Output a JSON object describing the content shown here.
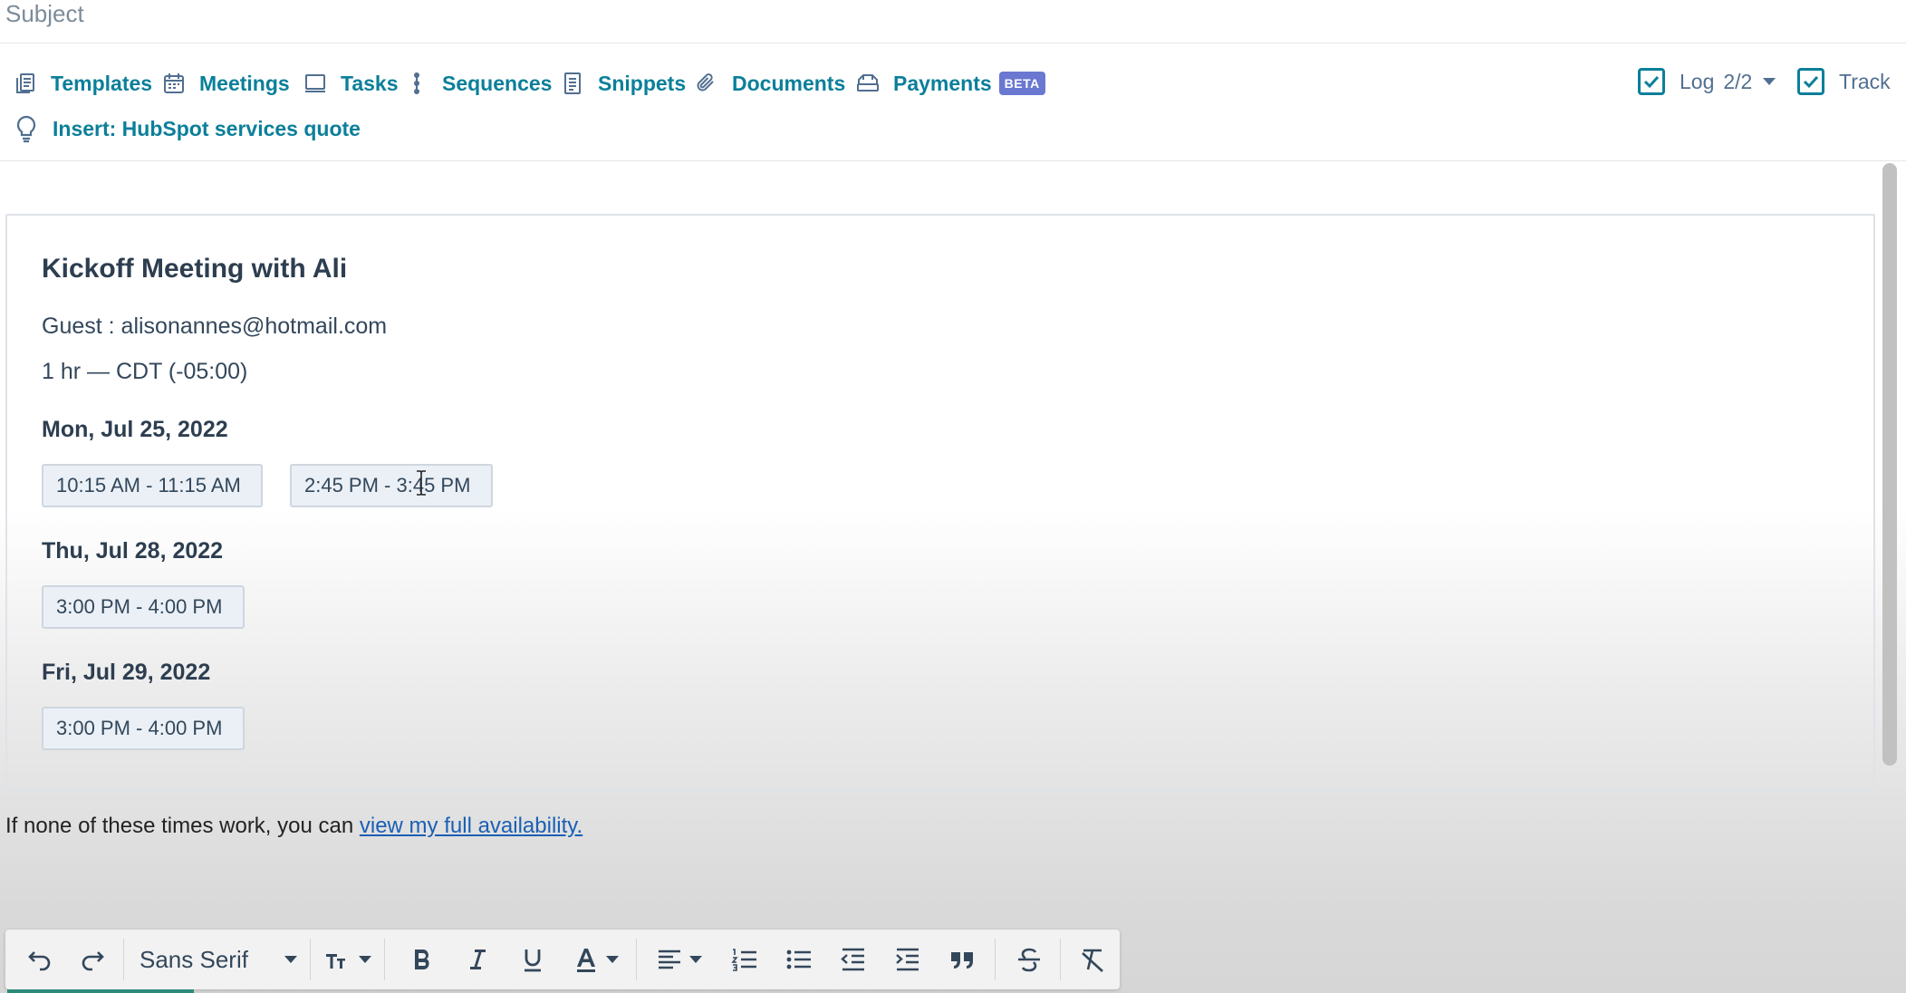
{
  "subject": {
    "label": "Subject"
  },
  "toolbar": {
    "templates": "Templates",
    "meetings": "Meetings",
    "tasks": "Tasks",
    "sequences": "Sequences",
    "snippets": "Snippets",
    "documents": "Documents",
    "payments": "Payments",
    "payments_badge": "BETA",
    "insert": "Insert: HubSpot services quote",
    "log_label": "Log",
    "log_count": "2/2",
    "track_label": "Track"
  },
  "card": {
    "title": "Kickoff Meeting with Ali",
    "guest": "Guest : alisonannes@hotmail.com",
    "duration": "1 hr — CDT (-05:00)",
    "days": [
      {
        "date": "Mon, Jul 25, 2022",
        "slots": [
          "10:15 AM - 11:15 AM",
          "2:45 PM - 3:45 PM"
        ]
      },
      {
        "date": "Thu, Jul 28, 2022",
        "slots": [
          "3:00 PM - 4:00 PM"
        ]
      },
      {
        "date": "Fri, Jul 29, 2022",
        "slots": [
          "3:00 PM - 4:00 PM"
        ]
      }
    ]
  },
  "footer": {
    "prefix": "If none of these times work, you can ",
    "link": "view my full availability."
  },
  "editor": {
    "font_family": "Sans Serif"
  },
  "colors": {
    "link_teal": "#0b7f9a",
    "beta_badge": "#6a78d1",
    "slot_bg": "#eaf0f6"
  }
}
